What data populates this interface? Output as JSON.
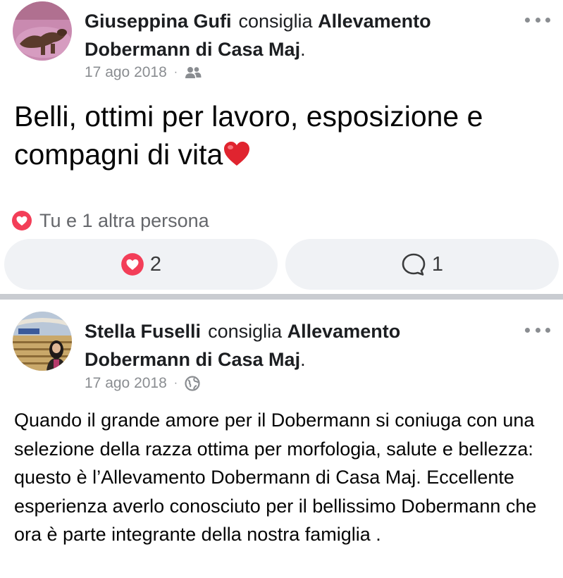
{
  "posts": [
    {
      "author": "Giuseppina Gufi",
      "verb": "consiglia",
      "page_line1": "Allevamento",
      "page_line2": "Dobermann di Casa Maj",
      "trailing_period": ".",
      "date": "17 ago 2018",
      "separator": "·",
      "audience_icon": "friends-icon",
      "text": "Belli, ottimi per lavoro, esposizione e compagni di vita",
      "emoji": "red-heart-emoji",
      "reactions_text": "Tu e 1 altra persona",
      "like_count": "2",
      "comment_count": "1"
    },
    {
      "author": "Stella Fuselli",
      "verb": "consiglia",
      "page_line1": "Allevamento",
      "page_line2": "Dobermann di Casa Maj",
      "trailing_period": ".",
      "date": "17 ago 2018",
      "separator": "·",
      "audience_icon": "globe-icon",
      "text": "Quando il grande amore per il Dobermann si coniuga con una selezione della razza ottima per morfologia, salute e bellezza: questo è l’Allevamento Dobermann di Casa Maj. Eccellente esperienza averlo conosciuto per il bellissimo Dobermann che ora è parte integrante della nostra famiglia ."
    }
  ],
  "colors": {
    "love_reaction": "#f33e58",
    "secondary_text": "#8a8d91",
    "pill_background": "#f0f2f5",
    "divider": "#c9ccd1"
  }
}
